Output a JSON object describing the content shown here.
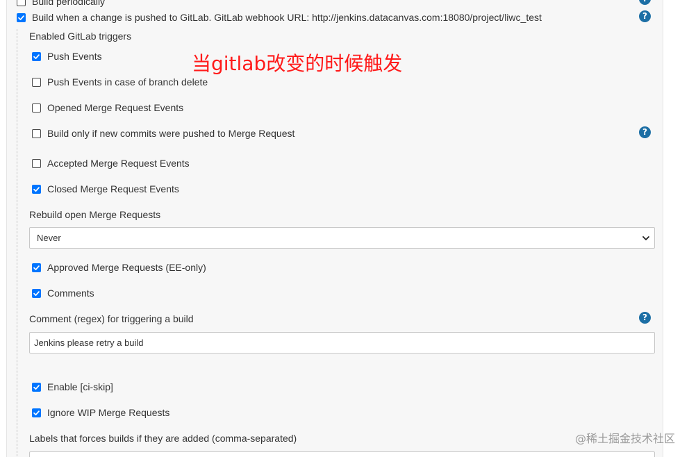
{
  "triggers": {
    "build_periodically": {
      "label": "Build periodically",
      "checked": false
    },
    "build_on_push": {
      "label": "Build when a change is pushed to GitLab. GitLab webhook URL: http://jenkins.datacanvas.com:18080/project/liwc_test",
      "checked": true
    }
  },
  "gitlab": {
    "section_title": "Enabled GitLab triggers",
    "push_events": {
      "label": "Push Events",
      "checked": true
    },
    "push_events_branch_delete": {
      "label": "Push Events in case of branch delete",
      "checked": false
    },
    "opened_mr_events": {
      "label": "Opened Merge Request Events",
      "checked": false
    },
    "build_only_new_commits": {
      "label": "Build only if new commits were pushed to Merge Request",
      "checked": false
    },
    "accepted_mr_events": {
      "label": "Accepted Merge Request Events",
      "checked": false
    },
    "closed_mr_events": {
      "label": "Closed Merge Request Events",
      "checked": true
    },
    "rebuild_open_mr": {
      "label": "Rebuild open Merge Requests",
      "selected": "Never"
    },
    "approved_mr": {
      "label": "Approved Merge Requests (EE-only)",
      "checked": true
    },
    "comments": {
      "label": "Comments",
      "checked": true
    },
    "comment_regex": {
      "label": "Comment (regex) for triggering a build",
      "value": "Jenkins please retry a build"
    },
    "ci_skip": {
      "label": "Enable [ci-skip]",
      "checked": true
    },
    "ignore_wip": {
      "label": "Ignore WIP Merge Requests",
      "checked": true
    },
    "labels_force_build": {
      "label": "Labels that forces builds if they are added (comma-separated)",
      "value": ""
    }
  },
  "help_icon_glyph": "?",
  "annotation": "当gitlab改变的时候触发",
  "watermark": "@稀土掘金技术社区",
  "colors": {
    "checkbox_checked": "#0075ff",
    "help_icon": "#1d6fa5",
    "annotation": "#ff1a1a",
    "panel_background": "#f7f7f7"
  }
}
